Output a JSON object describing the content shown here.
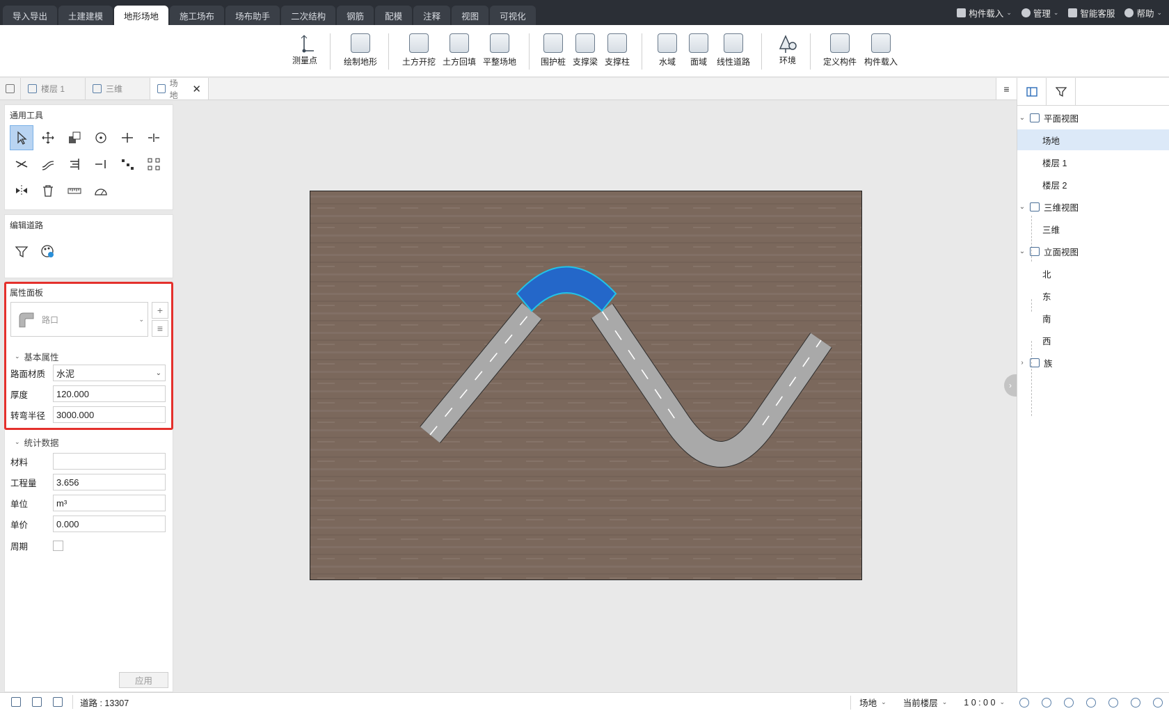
{
  "menu": {
    "tabs": [
      "导入导出",
      "土建建模",
      "地形场地",
      "施工场布",
      "场布助手",
      "二次结构",
      "钢筋",
      "配模",
      "注释",
      "视图",
      "可视化"
    ],
    "active_index": 2,
    "right": {
      "component_load": "构件载入",
      "manage": "管理",
      "service": "智能客服",
      "help": "帮助"
    }
  },
  "ribbon": {
    "measure": "测量点",
    "draw_terrain": "绘制地形",
    "excavate": "土方开挖",
    "backfill": "土方回填",
    "level_site": "平整场地",
    "fence_pile": "围护桩",
    "brace_beam": "支撑梁",
    "brace_column": "支撑柱",
    "water": "水域",
    "area": "面域",
    "linear_road": "线性道路",
    "environment": "环境",
    "define_component": "定义构件",
    "load_component": "构件载入"
  },
  "view_tabs": {
    "floor1": "楼层 1",
    "view3d": "三维",
    "site": "场地"
  },
  "tools_panel": {
    "title": "通用工具"
  },
  "edit_road_panel": {
    "title": "编辑道路"
  },
  "properties": {
    "title": "属性面板",
    "type_name": "路口",
    "basic_group": "基本属性",
    "material_label": "路面材质",
    "material_value": "水泥",
    "thickness_label": "厚度",
    "thickness_value": "120.000",
    "radius_label": "转弯半径",
    "radius_value": "3000.000",
    "stats_group": "统计数据",
    "stat_material_label": "材料",
    "stat_material_value": "",
    "quantity_label": "工程量",
    "quantity_value": "3.656",
    "unit_label": "单位",
    "unit_value": "m³",
    "price_label": "单价",
    "price_value": "0.000",
    "period_label": "周期",
    "period_checked": false,
    "apply_label": "应用"
  },
  "tree": {
    "plan_views": "平面视图",
    "site": "场地",
    "floor1": "楼层 1",
    "floor2": "楼层 2",
    "views_3d": "三维视图",
    "view3d": "三维",
    "elevations": "立面视图",
    "north": "北",
    "east": "东",
    "south": "南",
    "west": "西",
    "family": "族"
  },
  "status": {
    "road_info": "道路 : 13307",
    "view": "场地",
    "current_floor": "当前楼层",
    "scale": "1 0 : 0 0"
  },
  "colors": {
    "selected_fill": "#2467c9",
    "selected_outline": "#21c3e8",
    "road": "#a9a9a9",
    "ground": "#7e6a5e",
    "highlight": "#e4302c"
  }
}
